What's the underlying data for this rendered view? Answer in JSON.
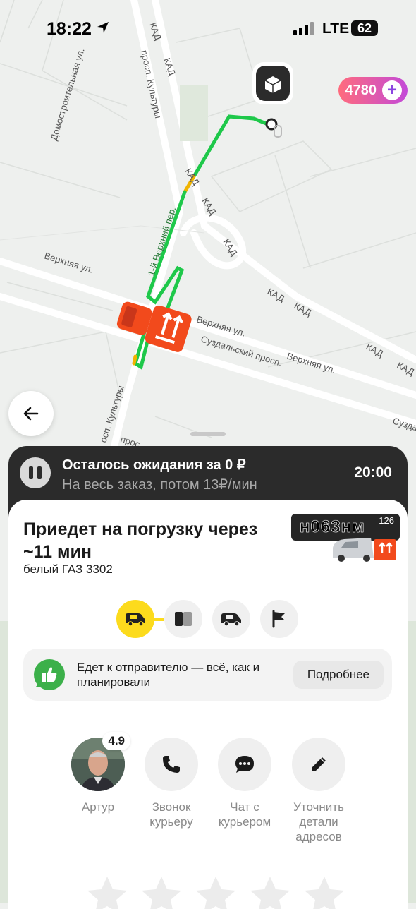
{
  "status_bar": {
    "time": "18:22",
    "network": "LTE",
    "battery": "62"
  },
  "points": {
    "value": "4780"
  },
  "map_labels": {
    "kad": "КАД",
    "domostroitelnaya": "Домостроительная ул.",
    "kultury": "просп. Культуры",
    "kultury_short": "осп. Культуры",
    "verkhnyaya": "Верхняя ул.",
    "verkhny_per": "1-й Верхний пер.",
    "suzdalsky": "Суздальский просп.",
    "suzda": "Сузда",
    "prosp": "прос"
  },
  "waiting": {
    "title": "Осталось ожидания за 0 ₽",
    "subtitle": "На весь заказ, потом 13₽/мин",
    "timer": "20:00"
  },
  "order": {
    "title": "Приедет на погрузку через ~11 мин",
    "vehicle": "белый ГАЗ 3302",
    "plate_number": "н063нм",
    "plate_region": "126"
  },
  "progress_steps": [
    {
      "name": "truck-step",
      "icon": "truck-icon",
      "active": true
    },
    {
      "name": "loading-step",
      "icon": "box-icon",
      "active": false
    },
    {
      "name": "delivery-step",
      "icon": "truck-icon",
      "active": false
    },
    {
      "name": "finish-step",
      "icon": "flag-icon",
      "active": false
    }
  ],
  "trip_status": {
    "text": "Едет к отправителю — всё, как и планировали",
    "details_button": "Подробнее"
  },
  "actions": [
    {
      "name": "courier-profile",
      "label": "Артур",
      "rating": "4.9"
    },
    {
      "name": "call-courier",
      "label": "Звонок курьеру"
    },
    {
      "name": "chat-courier",
      "label": "Чат с курьером"
    },
    {
      "name": "edit-addresses",
      "label": "Уточнить детали адресов"
    }
  ],
  "colors": {
    "accent_yellow": "#fcdb1d",
    "route_green": "#1ec84a",
    "truck_orange": "#f24a1c",
    "panel_dark": "#2b2b2b"
  }
}
